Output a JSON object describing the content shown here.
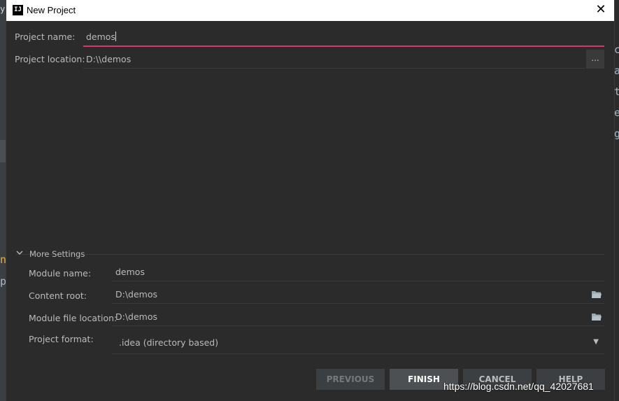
{
  "window": {
    "title": "New Project",
    "icon_text": "IJ"
  },
  "background_editor": {
    "left_chars": [
      "y",
      "n",
      "p"
    ],
    "right_chars": [
      "c",
      "a",
      "t",
      "e",
      "g"
    ]
  },
  "form": {
    "project_name": {
      "label": "Project name:",
      "value": "demos"
    },
    "project_location": {
      "label": "Project location:",
      "value": "D:\\\\demos",
      "browse_label": "..."
    }
  },
  "more_settings": {
    "label": "More Settings",
    "module_name": {
      "label": "Module name:",
      "value": "demos"
    },
    "content_root": {
      "label": "Content root:",
      "value": "D:\\demos"
    },
    "module_file_location": {
      "label": "Module file location:",
      "value": "D:\\demos"
    },
    "project_format": {
      "label": "Project format:",
      "value": ".idea (directory based)"
    }
  },
  "buttons": {
    "previous": "PREVIOUS",
    "finish": "FINISH",
    "cancel": "CANCEL",
    "help": "HELP"
  },
  "watermark": "https://blog.csdn.net/qq_42027681",
  "colors": {
    "focus_underline": "#d33a6b",
    "dialog_bg": "#2b2b2b",
    "titlebar_bg": "#ffffff"
  }
}
